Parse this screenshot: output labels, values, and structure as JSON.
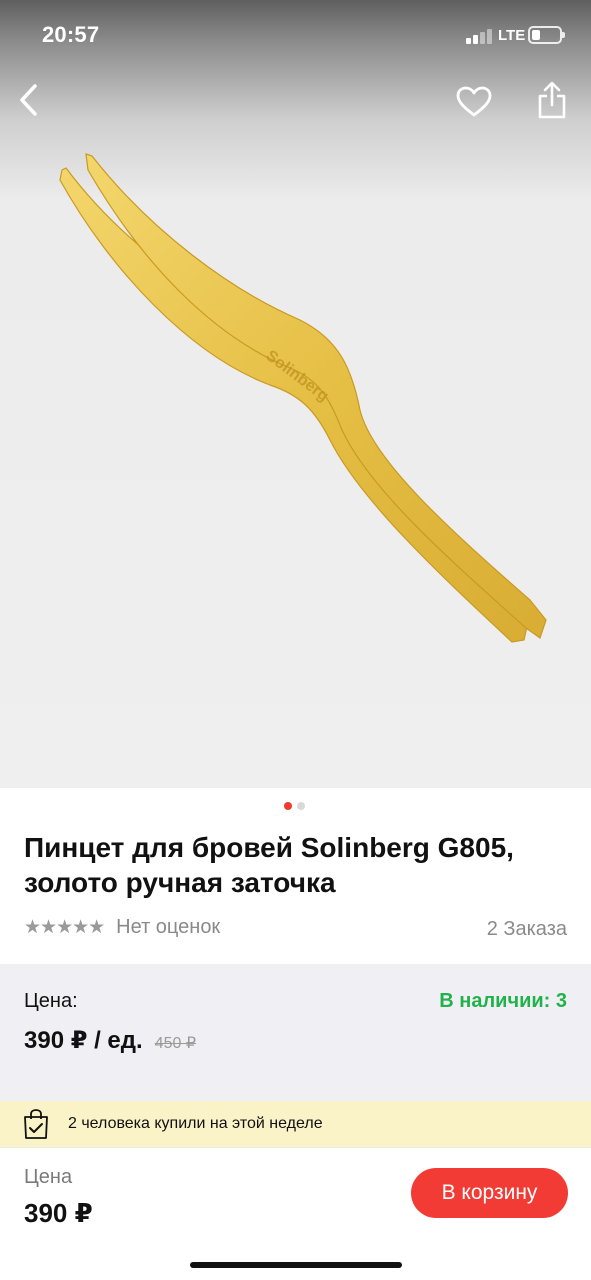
{
  "status_bar": {
    "time": "20:57",
    "network": "LTE"
  },
  "icons": {
    "back": "chevron-left-icon",
    "favorite": "heart-icon",
    "share": "share-icon",
    "promo": "shopping-bag-check-icon"
  },
  "product": {
    "image_alt": "gold tweezers",
    "engraving": "Solinberg",
    "image_count": 2,
    "image_active_index": 0,
    "title": "Пинцет для бровей Solinberg G805, золото ручная заточка",
    "stars": "★★★★★",
    "rating_text": "Нет оценок",
    "orders": "2 Заказа"
  },
  "price_block": {
    "label": "Цена:",
    "stock": "В наличии: 3",
    "price": "390 ₽ / ед.",
    "old_price": "450 ₽"
  },
  "promo": {
    "text": "2 человека купили на этой неделе"
  },
  "bottom_bar": {
    "price_label": "Цена",
    "price": "390 ₽",
    "cart_button": "В корзину"
  },
  "colors": {
    "accent": "#f23b34",
    "stock": "#21b24b",
    "promo_bg": "#faf3c8",
    "gold": "#e8c24a"
  }
}
